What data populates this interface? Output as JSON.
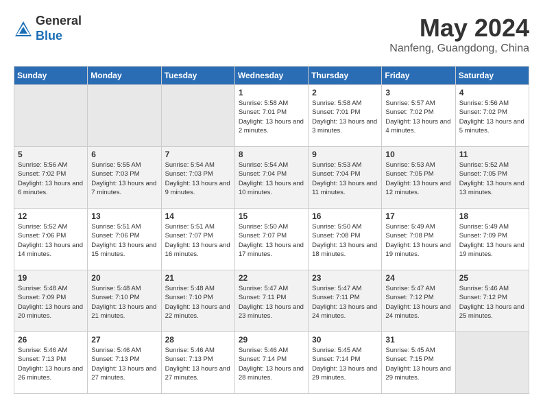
{
  "header": {
    "logo_general": "General",
    "logo_blue": "Blue",
    "month_year": "May 2024",
    "location": "Nanfeng, Guangdong, China"
  },
  "days_of_week": [
    "Sunday",
    "Monday",
    "Tuesday",
    "Wednesday",
    "Thursday",
    "Friday",
    "Saturday"
  ],
  "weeks": [
    [
      {
        "day": "",
        "empty": true
      },
      {
        "day": "",
        "empty": true
      },
      {
        "day": "",
        "empty": true
      },
      {
        "day": "1",
        "sunrise": "Sunrise: 5:58 AM",
        "sunset": "Sunset: 7:01 PM",
        "daylight": "Daylight: 13 hours and 2 minutes."
      },
      {
        "day": "2",
        "sunrise": "Sunrise: 5:58 AM",
        "sunset": "Sunset: 7:01 PM",
        "daylight": "Daylight: 13 hours and 3 minutes."
      },
      {
        "day": "3",
        "sunrise": "Sunrise: 5:57 AM",
        "sunset": "Sunset: 7:02 PM",
        "daylight": "Daylight: 13 hours and 4 minutes."
      },
      {
        "day": "4",
        "sunrise": "Sunrise: 5:56 AM",
        "sunset": "Sunset: 7:02 PM",
        "daylight": "Daylight: 13 hours and 5 minutes."
      }
    ],
    [
      {
        "day": "5",
        "sunrise": "Sunrise: 5:56 AM",
        "sunset": "Sunset: 7:02 PM",
        "daylight": "Daylight: 13 hours and 6 minutes."
      },
      {
        "day": "6",
        "sunrise": "Sunrise: 5:55 AM",
        "sunset": "Sunset: 7:03 PM",
        "daylight": "Daylight: 13 hours and 7 minutes."
      },
      {
        "day": "7",
        "sunrise": "Sunrise: 5:54 AM",
        "sunset": "Sunset: 7:03 PM",
        "daylight": "Daylight: 13 hours and 9 minutes."
      },
      {
        "day": "8",
        "sunrise": "Sunrise: 5:54 AM",
        "sunset": "Sunset: 7:04 PM",
        "daylight": "Daylight: 13 hours and 10 minutes."
      },
      {
        "day": "9",
        "sunrise": "Sunrise: 5:53 AM",
        "sunset": "Sunset: 7:04 PM",
        "daylight": "Daylight: 13 hours and 11 minutes."
      },
      {
        "day": "10",
        "sunrise": "Sunrise: 5:53 AM",
        "sunset": "Sunset: 7:05 PM",
        "daylight": "Daylight: 13 hours and 12 minutes."
      },
      {
        "day": "11",
        "sunrise": "Sunrise: 5:52 AM",
        "sunset": "Sunset: 7:05 PM",
        "daylight": "Daylight: 13 hours and 13 minutes."
      }
    ],
    [
      {
        "day": "12",
        "sunrise": "Sunrise: 5:52 AM",
        "sunset": "Sunset: 7:06 PM",
        "daylight": "Daylight: 13 hours and 14 minutes."
      },
      {
        "day": "13",
        "sunrise": "Sunrise: 5:51 AM",
        "sunset": "Sunset: 7:06 PM",
        "daylight": "Daylight: 13 hours and 15 minutes."
      },
      {
        "day": "14",
        "sunrise": "Sunrise: 5:51 AM",
        "sunset": "Sunset: 7:07 PM",
        "daylight": "Daylight: 13 hours and 16 minutes."
      },
      {
        "day": "15",
        "sunrise": "Sunrise: 5:50 AM",
        "sunset": "Sunset: 7:07 PM",
        "daylight": "Daylight: 13 hours and 17 minutes."
      },
      {
        "day": "16",
        "sunrise": "Sunrise: 5:50 AM",
        "sunset": "Sunset: 7:08 PM",
        "daylight": "Daylight: 13 hours and 18 minutes."
      },
      {
        "day": "17",
        "sunrise": "Sunrise: 5:49 AM",
        "sunset": "Sunset: 7:08 PM",
        "daylight": "Daylight: 13 hours and 19 minutes."
      },
      {
        "day": "18",
        "sunrise": "Sunrise: 5:49 AM",
        "sunset": "Sunset: 7:09 PM",
        "daylight": "Daylight: 13 hours and 19 minutes."
      }
    ],
    [
      {
        "day": "19",
        "sunrise": "Sunrise: 5:48 AM",
        "sunset": "Sunset: 7:09 PM",
        "daylight": "Daylight: 13 hours and 20 minutes."
      },
      {
        "day": "20",
        "sunrise": "Sunrise: 5:48 AM",
        "sunset": "Sunset: 7:10 PM",
        "daylight": "Daylight: 13 hours and 21 minutes."
      },
      {
        "day": "21",
        "sunrise": "Sunrise: 5:48 AM",
        "sunset": "Sunset: 7:10 PM",
        "daylight": "Daylight: 13 hours and 22 minutes."
      },
      {
        "day": "22",
        "sunrise": "Sunrise: 5:47 AM",
        "sunset": "Sunset: 7:11 PM",
        "daylight": "Daylight: 13 hours and 23 minutes."
      },
      {
        "day": "23",
        "sunrise": "Sunrise: 5:47 AM",
        "sunset": "Sunset: 7:11 PM",
        "daylight": "Daylight: 13 hours and 24 minutes."
      },
      {
        "day": "24",
        "sunrise": "Sunrise: 5:47 AM",
        "sunset": "Sunset: 7:12 PM",
        "daylight": "Daylight: 13 hours and 24 minutes."
      },
      {
        "day": "25",
        "sunrise": "Sunrise: 5:46 AM",
        "sunset": "Sunset: 7:12 PM",
        "daylight": "Daylight: 13 hours and 25 minutes."
      }
    ],
    [
      {
        "day": "26",
        "sunrise": "Sunrise: 5:46 AM",
        "sunset": "Sunset: 7:13 PM",
        "daylight": "Daylight: 13 hours and 26 minutes."
      },
      {
        "day": "27",
        "sunrise": "Sunrise: 5:46 AM",
        "sunset": "Sunset: 7:13 PM",
        "daylight": "Daylight: 13 hours and 27 minutes."
      },
      {
        "day": "28",
        "sunrise": "Sunrise: 5:46 AM",
        "sunset": "Sunset: 7:13 PM",
        "daylight": "Daylight: 13 hours and 27 minutes."
      },
      {
        "day": "29",
        "sunrise": "Sunrise: 5:46 AM",
        "sunset": "Sunset: 7:14 PM",
        "daylight": "Daylight: 13 hours and 28 minutes."
      },
      {
        "day": "30",
        "sunrise": "Sunrise: 5:45 AM",
        "sunset": "Sunset: 7:14 PM",
        "daylight": "Daylight: 13 hours and 29 minutes."
      },
      {
        "day": "31",
        "sunrise": "Sunrise: 5:45 AM",
        "sunset": "Sunset: 7:15 PM",
        "daylight": "Daylight: 13 hours and 29 minutes."
      },
      {
        "day": "",
        "empty": true
      }
    ]
  ]
}
